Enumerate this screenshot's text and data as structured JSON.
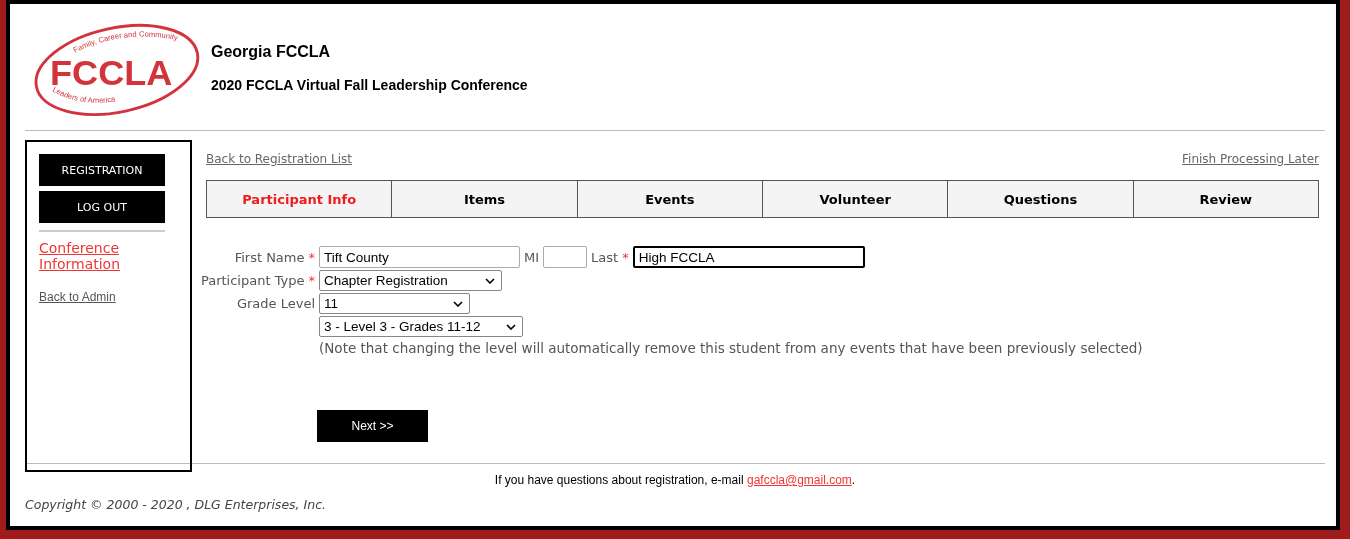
{
  "logo": {
    "mark": "FCCLA",
    "top_text": "Family, Career and Community",
    "bottom_text": "Leaders of America"
  },
  "header": {
    "org": "Georgia FCCLA",
    "event": "2020 FCCLA Virtual Fall Leadership Conference"
  },
  "sidebar": {
    "buttons": [
      "REGISTRATION",
      "LOG OUT"
    ],
    "links": [
      {
        "label": "Conference Information",
        "kind": "primary"
      },
      {
        "label": "Back to Admin",
        "kind": "secondary"
      }
    ]
  },
  "top_links": {
    "back": "Back to Registration List",
    "later": "Finish Processing Later"
  },
  "tabs": [
    {
      "label": "Participant Info",
      "selected": true
    },
    {
      "label": "Items",
      "selected": false
    },
    {
      "label": "Events",
      "selected": false
    },
    {
      "label": "Volunteer",
      "selected": false
    },
    {
      "label": "Questions",
      "selected": false
    },
    {
      "label": "Review",
      "selected": false
    }
  ],
  "form": {
    "first_name": {
      "label": "First Name",
      "required": true,
      "value": "Tift County"
    },
    "mi": {
      "label": "MI"
    },
    "last": {
      "label": "Last",
      "required": true,
      "value": "High FCCLA",
      "focused": true
    },
    "participant_type": {
      "label": "Participant Type",
      "required": true,
      "value": "Chapter Registration"
    },
    "grade_level": {
      "label": "Grade Level",
      "value": "11"
    },
    "level": {
      "value": "3 - Level 3 - Grades 11-12"
    },
    "note": "(Note that changing the level will automatically remove this student from any events that have been previously selected)",
    "required_mark": "*"
  },
  "next_button": "Next >>",
  "footer": {
    "question": "If you have questions about registration, e-mail",
    "email": "gafccla@gmail.com",
    "period": ".",
    "copyright": "Copyright © 2000 - 2020 , DLG Enterprises, Inc."
  }
}
